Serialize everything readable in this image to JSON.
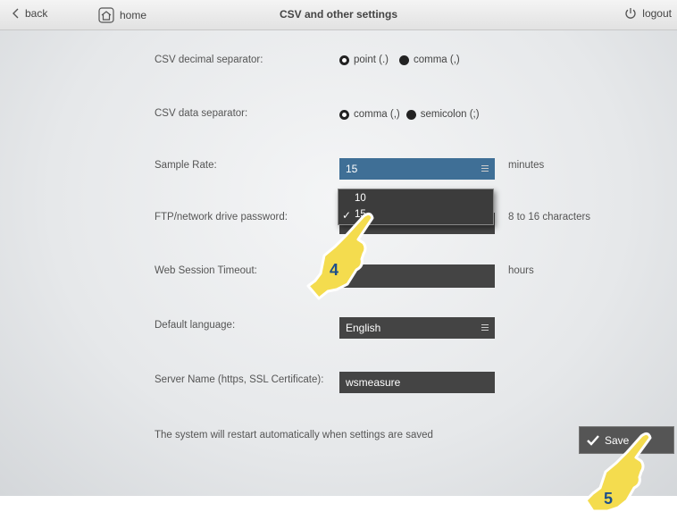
{
  "topbar": {
    "back_label": "back",
    "home_label": "home",
    "title": "CSV and other settings",
    "logout_label": "logout"
  },
  "settings": {
    "decimal_separator": {
      "label": "CSV decimal separator:",
      "options": [
        "point (.)",
        "comma (,)"
      ],
      "selected": "point (.)"
    },
    "data_separator": {
      "label": "CSV data separator:",
      "options": [
        "comma (,)",
        "semicolon (;)"
      ],
      "selected": "comma (,)"
    },
    "sample_rate": {
      "label": "Sample Rate:",
      "value": "15",
      "unit": "minutes",
      "dropdown_options": [
        "10",
        "15"
      ],
      "dropdown_checked": "15"
    },
    "ftp_password": {
      "label": "FTP/network drive password:",
      "hint": "8 to 16 characters"
    },
    "web_session_timeout": {
      "label": "Web Session Timeout:",
      "unit": "hours"
    },
    "default_language": {
      "label": "Default language:",
      "value": "English"
    },
    "server_name": {
      "label": "Server Name (https, SSL Certificate):",
      "value": "wsmeasure"
    }
  },
  "footer": {
    "restart_note": "The system will restart automatically when settings are saved",
    "save_label": "Save"
  },
  "annotations": {
    "step_4": "4",
    "step_5": "5",
    "hand_color": "#f2d94b"
  }
}
